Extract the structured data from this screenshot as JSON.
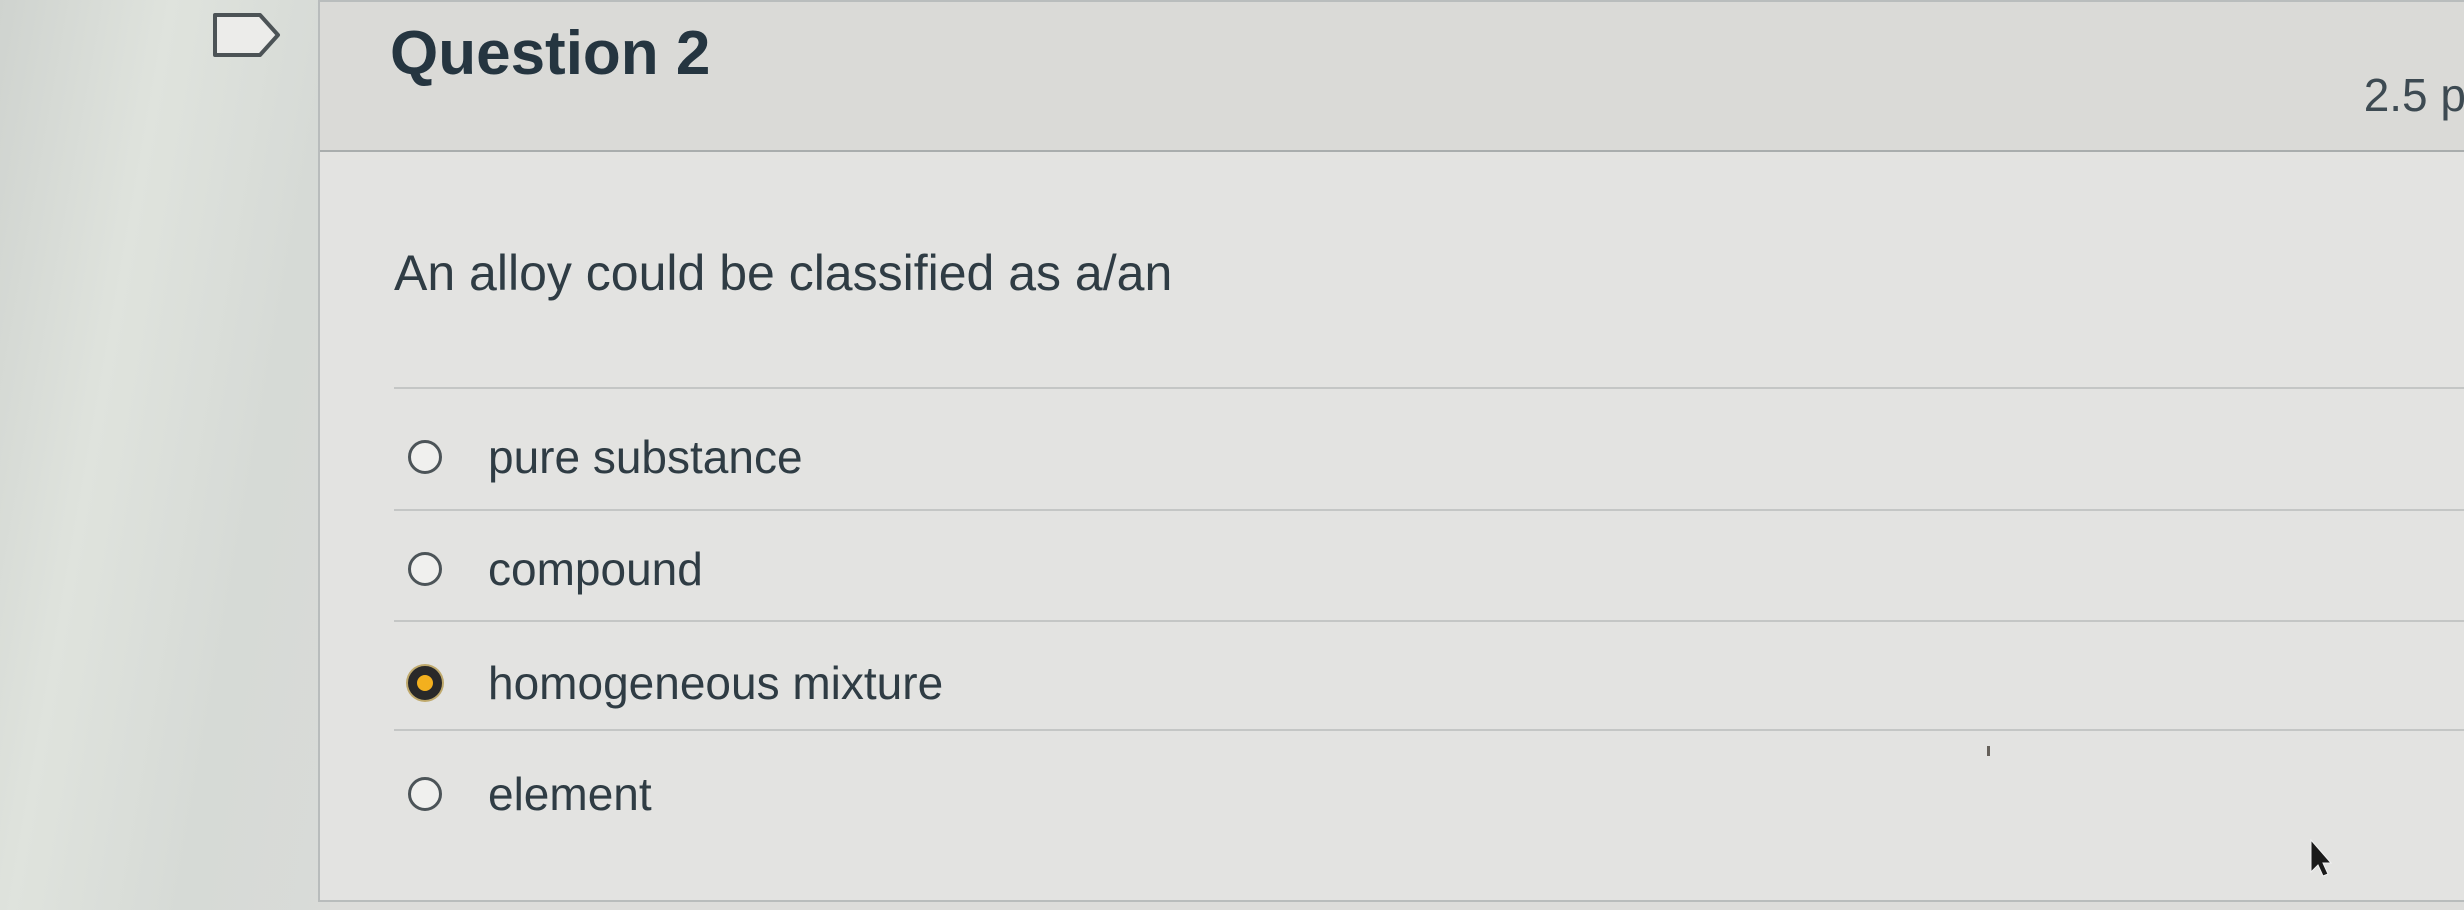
{
  "question": {
    "title": "Question 2",
    "points": "2.5 p",
    "text": "An alloy could be classified as a/an"
  },
  "answers": [
    {
      "label": "pure substance",
      "selected": false
    },
    {
      "label": "compound",
      "selected": false
    },
    {
      "label": "homogeneous mixture",
      "selected": true
    },
    {
      "label": "element",
      "selected": false
    }
  ],
  "icons": {
    "flag": "flag-icon",
    "cursor": "mouse-cursor-icon"
  },
  "colors": {
    "selected_radio": "#f3b01e",
    "title_text": "#253540"
  }
}
